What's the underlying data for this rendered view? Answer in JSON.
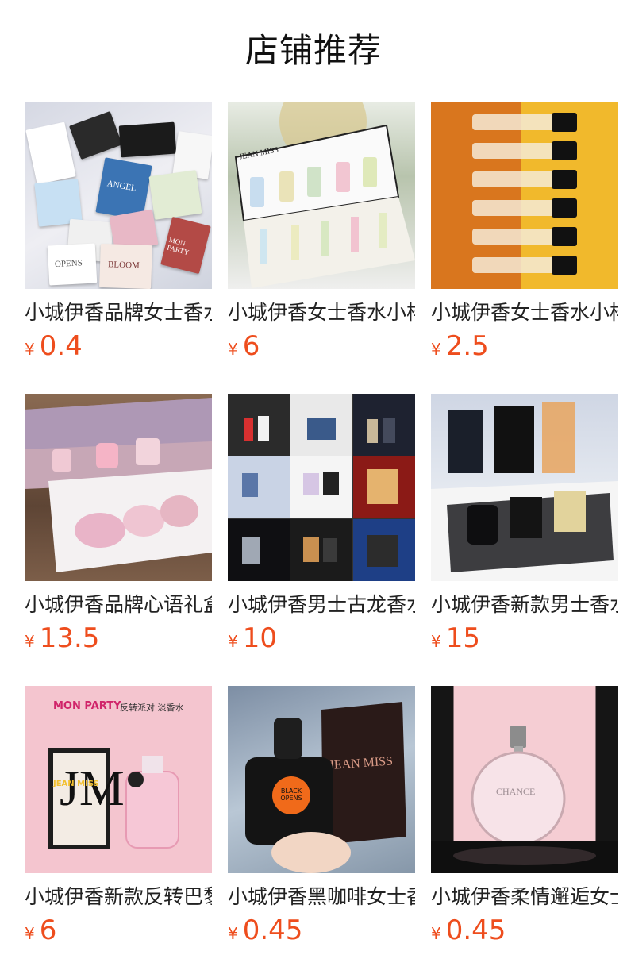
{
  "page": {
    "title": "店铺推荐"
  },
  "products": [
    {
      "name": "小城伊香品牌女士香水小样",
      "currency": "¥",
      "price": "0.4",
      "image_icon": "perfume-sample-cards-icon"
    },
    {
      "name": "小城伊香女士香水小样礼盒",
      "currency": "¥",
      "price": "6",
      "image_icon": "perfume-gift-box-icon"
    },
    {
      "name": "小城伊香女士香水小样试管",
      "currency": "¥",
      "price": "2.5",
      "image_icon": "perfume-vials-icon"
    },
    {
      "name": "小城伊香品牌心语礼盒套装",
      "currency": "¥",
      "price": "13.5",
      "image_icon": "perfume-gift-set-icon"
    },
    {
      "name": "小城伊香男士古龙香水礼盒",
      "currency": "¥",
      "price": "10",
      "image_icon": "mens-cologne-collage-icon"
    },
    {
      "name": "小城伊香新款男士香水礼盒",
      "currency": "¥",
      "price": "15",
      "image_icon": "mens-perfume-box-icon"
    },
    {
      "name": "小城伊香新款反转巴黎香水",
      "currency": "¥",
      "price": "6",
      "image_icon": "mon-party-perfume-icon"
    },
    {
      "name": "小城伊香黑咖啡女士香水",
      "currency": "¥",
      "price": "0.45",
      "image_icon": "black-opens-perfume-icon"
    },
    {
      "name": "小城伊香柔情邂逅女士香水",
      "currency": "¥",
      "price": "0.45",
      "image_icon": "chance-perfume-icon"
    }
  ],
  "image_text": {
    "jean_miss": "JEAN MISS",
    "mon_party": "MON PARTY",
    "mon_party_sub": "反转派对 淡香水",
    "black_opens": "BLACK OPENS",
    "chance": "CHANCE",
    "bloom": "BLOOM",
    "angel": "ANGEL",
    "opens": "OPENS",
    "mon_party_card": "MON PARTY"
  },
  "colors": {
    "price": "#ee4d1d",
    "title": "#111111"
  }
}
